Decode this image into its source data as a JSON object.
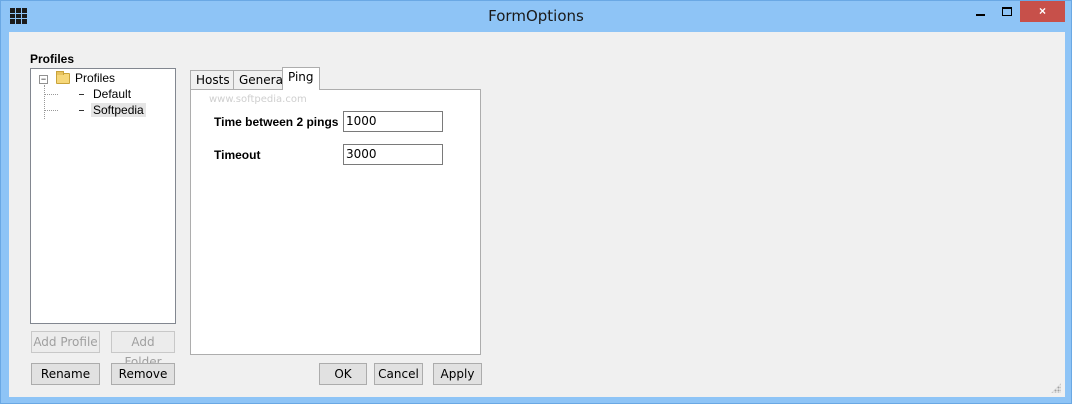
{
  "window": {
    "title": "FormOptions",
    "controls": {
      "minimize": "minimize",
      "maximize": "maximize",
      "close": "×"
    }
  },
  "profiles": {
    "label": "Profiles",
    "tree": {
      "root": "Profiles",
      "children": [
        "Default",
        "Softpedia"
      ],
      "selected": "Softpedia"
    },
    "buttons": {
      "add_profile": "Add Profile",
      "add_folder": "Add Folder",
      "rename": "Rename",
      "remove": "Remove"
    }
  },
  "tabs": {
    "items": [
      "Hosts",
      "General",
      "Ping"
    ],
    "active": "Ping",
    "watermark": "www.softpedia.com"
  },
  "ping": {
    "interval_label": "Time between 2 pings",
    "interval_value": "1000",
    "timeout_label": "Timeout",
    "timeout_value": "3000"
  },
  "dialog_buttons": {
    "ok": "OK",
    "cancel": "Cancel",
    "apply": "Apply"
  }
}
